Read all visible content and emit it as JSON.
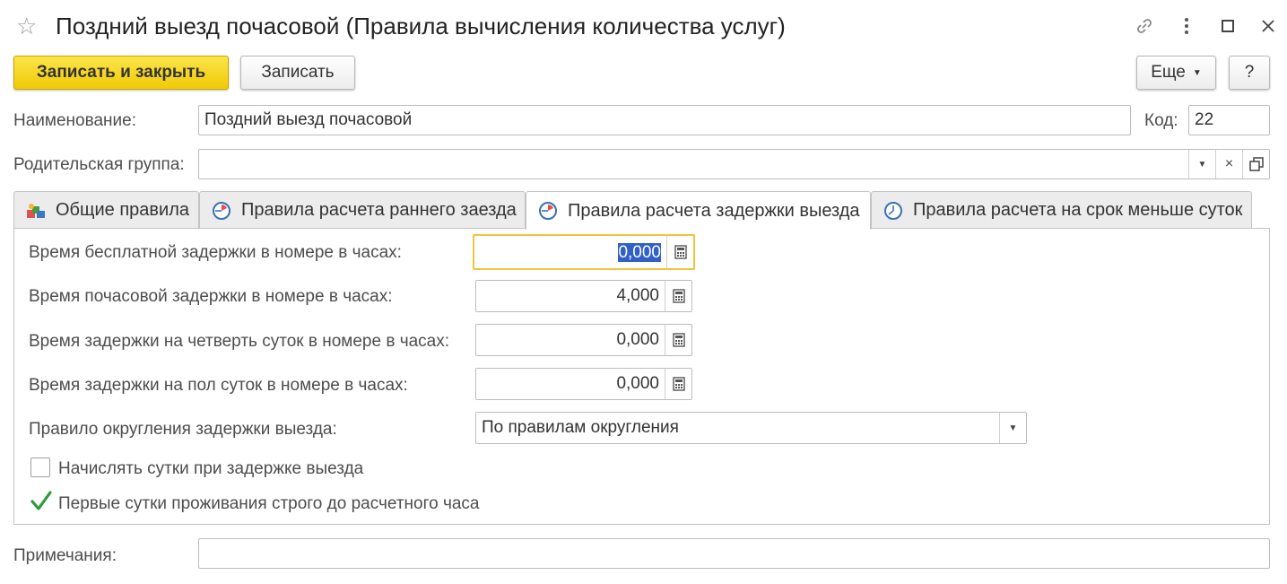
{
  "window": {
    "title": "Поздний выезд почасовой (Правила вычисления количества услуг)",
    "icons": [
      "star-icon",
      "link-icon",
      "more-vert-icon",
      "maximize-icon",
      "close-icon"
    ]
  },
  "toolbar": {
    "save_close_label": "Записать и закрыть",
    "save_label": "Записать",
    "more_label": "Еще",
    "help_label": "?"
  },
  "form": {
    "name_label": "Наименование:",
    "name_value": "Поздний выезд почасовой",
    "code_label": "Код:",
    "code_value": "22",
    "parent_label": "Родительская группа:",
    "parent_value": "",
    "notes_label": "Примечания:",
    "notes_value": ""
  },
  "tabs": [
    {
      "label": "Общие правила",
      "icon": "rules-icon",
      "active": false
    },
    {
      "label": "Правила расчета раннего заезда",
      "icon": "clock-icon",
      "active": false
    },
    {
      "label": "Правила расчета задержки выезда",
      "icon": "clock-icon",
      "active": true
    },
    {
      "label": "Правила расчета на срок меньше суток",
      "icon": "clock-icon",
      "active": false
    }
  ],
  "checkout": {
    "fields": [
      {
        "label": "Время бесплатной задержки в номере в часах:",
        "value": "0,000"
      },
      {
        "label": "Время почасовой задержки в номере в часах:",
        "value": "4,000"
      },
      {
        "label": "Время задержки на четверть суток в номере в часах:",
        "value": "0,000"
      },
      {
        "label": "Время задержки на пол суток в номере в часах:",
        "value": "0,000"
      }
    ],
    "rounding_label": "Правило округления задержки выезда:",
    "rounding_value": "По правилам округления",
    "checkboxes": [
      {
        "label": "Начислять сутки при задержке выезда",
        "checked": false
      },
      {
        "label": "Первые сутки проживания строго до расчетного часа",
        "checked": true
      }
    ]
  },
  "colors": {
    "primary_button": "#f1ca07",
    "focus_border": "#f3c23b",
    "selection": "#2f5fc7",
    "check": "#2e9a3e"
  }
}
